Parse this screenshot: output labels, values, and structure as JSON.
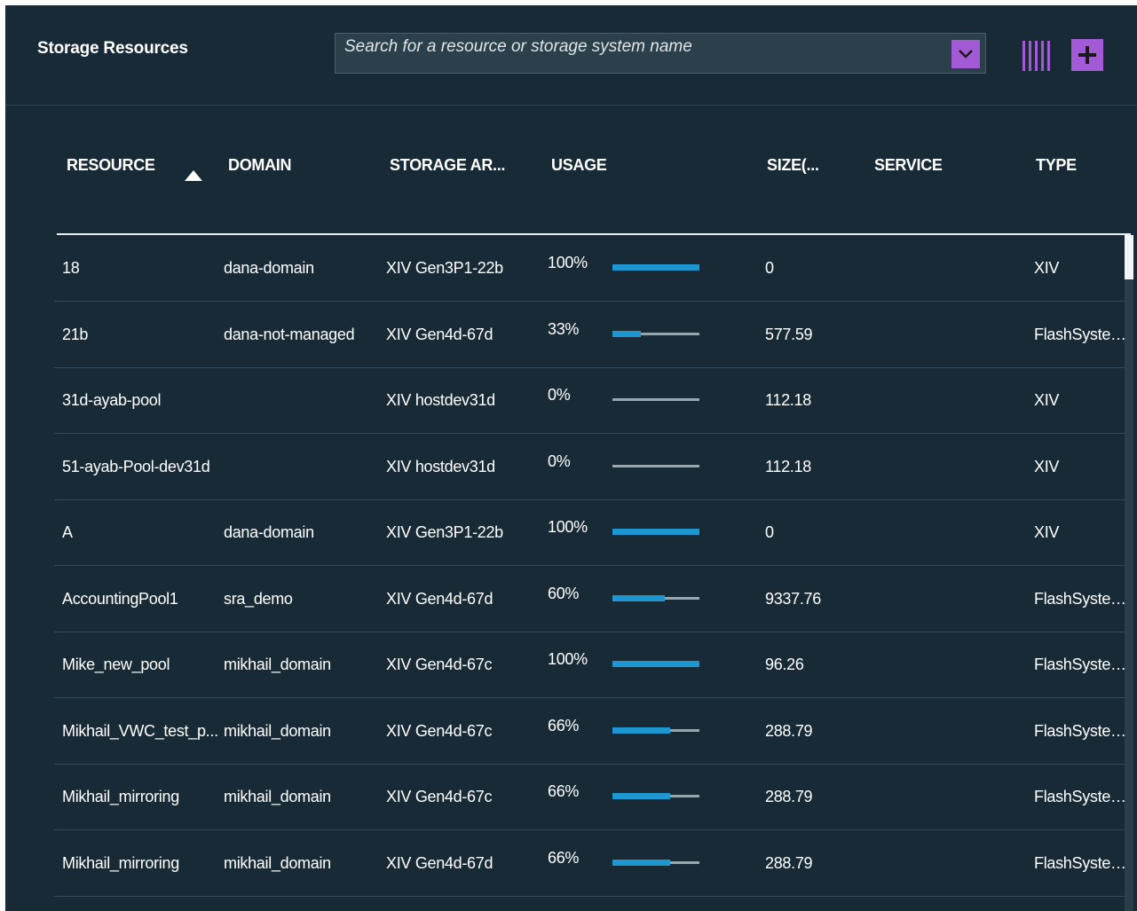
{
  "header": {
    "title": "Storage Resources",
    "search_placeholder": "Search for a resource or storage system name"
  },
  "colors": {
    "background": "#182a35",
    "accent": "#a35ad6",
    "usage_fill": "#1e96cf",
    "usage_track": "#9aa6ae"
  },
  "icons": {
    "dropdown": "chevron-down-icon",
    "columns": "columns-icon",
    "add": "plus-icon",
    "sort": "sort-ascending-icon"
  },
  "table": {
    "columns": [
      "RESOURCE",
      "DOMAIN",
      "STORAGE AR...",
      "USAGE",
      "SIZE(...",
      "SERVICE",
      "TYPE"
    ],
    "sort_column": "RESOURCE",
    "sort_direction": "ascending",
    "rows": [
      {
        "resource": "18",
        "domain": "dana-domain",
        "storage_array": "XIV Gen3P1-22b",
        "usage": "100%",
        "usage_fraction": 1.0,
        "size": "0",
        "service": "",
        "type": "XIV"
      },
      {
        "resource": "21b",
        "domain": "dana-not-managed",
        "storage_array": "XIV Gen4d-67d",
        "usage": "33%",
        "usage_fraction": 0.33,
        "size": "577.59",
        "service": "",
        "type": "FlashSystem ..."
      },
      {
        "resource": "31d-ayab-pool",
        "domain": "",
        "storage_array": "XIV hostdev31d",
        "usage": "0%",
        "usage_fraction": 0.0,
        "size": "112.18",
        "service": "",
        "type": "XIV"
      },
      {
        "resource": "51-ayab-Pool-dev31d",
        "domain": "",
        "storage_array": "XIV hostdev31d",
        "usage": "0%",
        "usage_fraction": 0.0,
        "size": "112.18",
        "service": "",
        "type": "XIV"
      },
      {
        "resource": "A",
        "domain": "dana-domain",
        "storage_array": "XIV Gen3P1-22b",
        "usage": "100%",
        "usage_fraction": 1.0,
        "size": "0",
        "service": "",
        "type": "XIV"
      },
      {
        "resource": "AccountingPool1",
        "domain": "sra_demo",
        "storage_array": "XIV Gen4d-67d",
        "usage": "60%",
        "usage_fraction": 0.6,
        "size": "9337.76",
        "service": "",
        "type": "FlashSystem ..."
      },
      {
        "resource": "Mike_new_pool",
        "domain": "mikhail_domain",
        "storage_array": "XIV Gen4d-67c",
        "usage": "100%",
        "usage_fraction": 1.0,
        "size": "96.26",
        "service": "",
        "type": "FlashSystem ..."
      },
      {
        "resource": "Mikhail_VWC_test_p...",
        "domain": "mikhail_domain",
        "storage_array": "XIV Gen4d-67c",
        "usage": "66%",
        "usage_fraction": 0.66,
        "size": "288.79",
        "service": "",
        "type": "FlashSystem ..."
      },
      {
        "resource": "Mikhail_mirroring",
        "domain": "mikhail_domain",
        "storage_array": "XIV Gen4d-67c",
        "usage": "66%",
        "usage_fraction": 0.66,
        "size": "288.79",
        "service": "",
        "type": "FlashSystem ..."
      },
      {
        "resource": "Mikhail_mirroring",
        "domain": "mikhail_domain",
        "storage_array": "XIV Gen4d-67d",
        "usage": "66%",
        "usage_fraction": 0.66,
        "size": "288.79",
        "service": "",
        "type": "FlashSystem ..."
      }
    ]
  }
}
